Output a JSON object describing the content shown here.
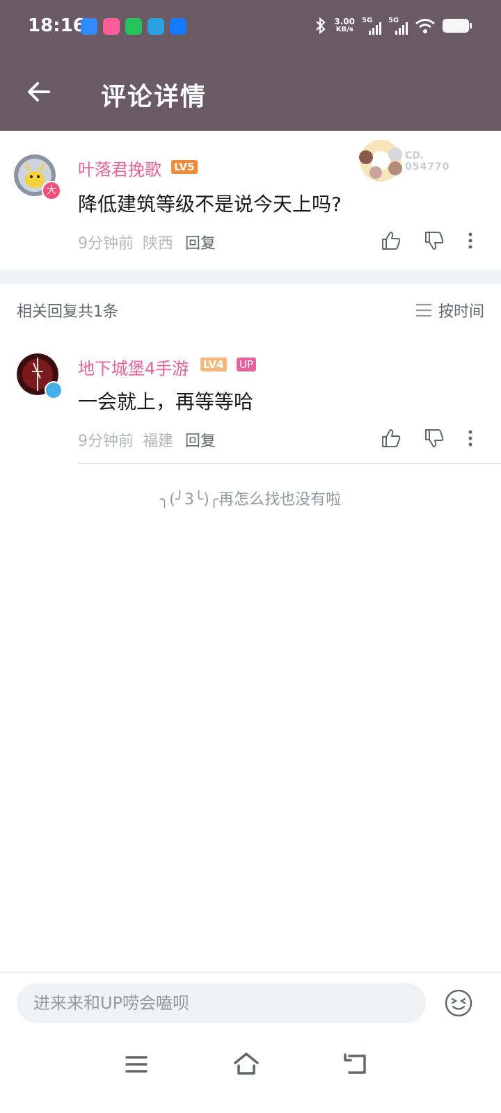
{
  "status": {
    "time": "18:16",
    "speed_value": "3.00",
    "speed_unit": "KB/s",
    "sim1": "5G",
    "sim2": "5G"
  },
  "header": {
    "title": "评论详情"
  },
  "main_comment": {
    "username": "叶落君挽歌",
    "level": "LV5",
    "content": "降低建筑等级不是说今天上吗?",
    "time": "9分钟前",
    "location": "陕西",
    "reply_label": "回复",
    "avatar_badge": "大",
    "decoration_text": "CD.",
    "decoration_number": "054770"
  },
  "replies_section": {
    "count_label": "相关回复共1条",
    "sort_label": "按时间"
  },
  "replies": [
    {
      "username": "地下城堡4手游",
      "level": "LV4",
      "badge": "UP",
      "content": "一会就上，再等等哈",
      "time": "9分钟前",
      "location": "福建",
      "reply_label": "回复"
    }
  ],
  "end_message": "╮(╯3╰)╭再怎么找也没有啦",
  "input": {
    "placeholder": "进来来和UP唠会嗑呗"
  },
  "colors": {
    "header_bg": "#6a5a63",
    "username_pink": "#e8619a",
    "lv5_orange": "#f28b38",
    "lv4_peach": "#f5b77a"
  }
}
